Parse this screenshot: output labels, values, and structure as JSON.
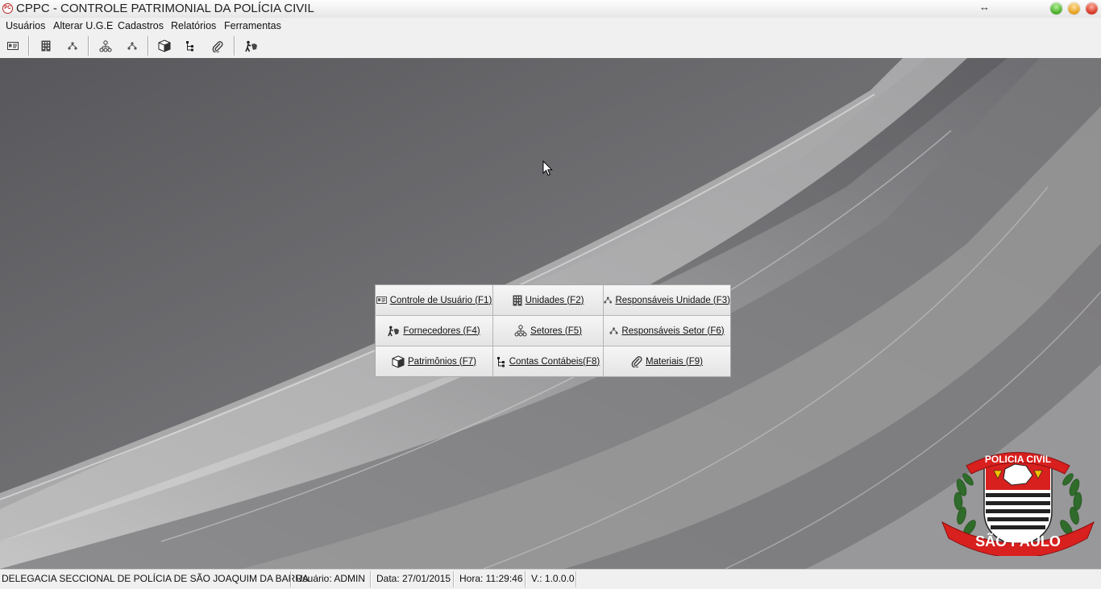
{
  "window": {
    "title": "CPPC - CONTROLE PATRIMONIAL DA POLÍCIA CIVIL",
    "app_icon_text": "PC"
  },
  "menubar": {
    "items": [
      "Usuários",
      "Alterar U.G.E",
      "Cadastros",
      "Relatórios",
      "Ferramentas"
    ]
  },
  "toolbar": {
    "buttons": [
      {
        "icon": "id-card-icon"
      },
      {
        "icon": "building-icon"
      },
      {
        "icon": "org-tree-icon"
      },
      {
        "icon": "sector-network-icon"
      },
      {
        "icon": "org-tree-small-icon"
      },
      {
        "icon": "box-icon"
      },
      {
        "icon": "hierarchy-icon"
      },
      {
        "icon": "paperclip-icon"
      },
      {
        "icon": "supplier-person-icon"
      }
    ]
  },
  "quick_panel": {
    "buttons": [
      {
        "label": "Controle de Usuário (F1)",
        "icon": "id-card-icon"
      },
      {
        "label": "Unidades (F2)",
        "icon": "building-icon"
      },
      {
        "label": "Responsáveis Unidade (F3)",
        "icon": "org-tree-icon"
      },
      {
        "label": "Fornecedores (F4)",
        "icon": "supplier-person-icon"
      },
      {
        "label": "Setores (F5)",
        "icon": "sector-network-icon"
      },
      {
        "label": "Responsáveis Setor (F6)",
        "icon": "org-tree-icon"
      },
      {
        "label": "Patrimônios (F7)",
        "icon": "box-icon"
      },
      {
        "label": "Contas Contábeis(F8)",
        "icon": "hierarchy-icon"
      },
      {
        "label": "Materiais (F9)",
        "icon": "paperclip-icon"
      }
    ]
  },
  "badge": {
    "top_text": "POLICIA CIVIL",
    "bottom_text": "SÃO PAULO"
  },
  "statusbar": {
    "unit": "DELEGACIA SECCIONAL DE POLÍCIA DE SÃO JOAQUIM DA BARRA",
    "user": "Usuário: ADMIN",
    "date": "Data: 27/01/2015",
    "time": "Hora: 11:29:46",
    "version": "V.: 1.0.0.0"
  },
  "colors": {
    "badge_red": "#d8201f",
    "laurel_green": "#2f6b2a"
  }
}
